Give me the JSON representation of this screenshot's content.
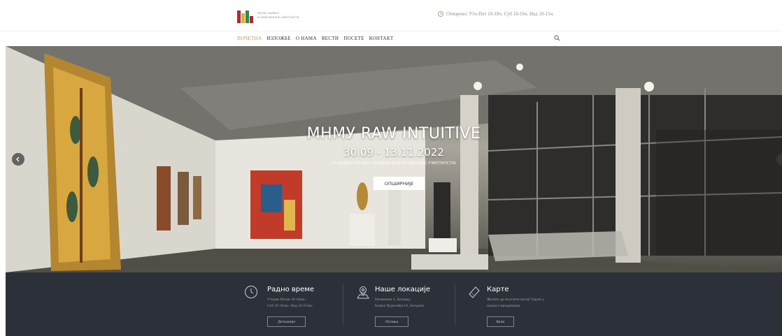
{
  "header": {
    "logo_line1": "музеј наивне",
    "logo_line2": "и маргиналне уметности",
    "hours": "Отворено: Уто-Пет 10-18ч. Суб 10-16ч. Нед 10-15ч."
  },
  "nav": {
    "items": [
      {
        "label": "ПОЧЕТНА",
        "active": true
      },
      {
        "label": "ИЗЛОЖБЕ",
        "active": false
      },
      {
        "label": "О НАМА",
        "active": false
      },
      {
        "label": "ВЕСТИ",
        "active": false
      },
      {
        "label": "ПОСЕТЕ",
        "active": false
      },
      {
        "label": "КОНТАКТ",
        "active": false
      }
    ],
    "search_icon": "search-icon"
  },
  "hero": {
    "title": "MHMУ RAW INTUITIVE",
    "dates": "30.09 - 13.11.2022",
    "subtitle": "ГАЛЕРИЈА МУЗЕЈА НАИВНЕ И МАРГИНАЛНЕ УМЕТНОСТИ",
    "button": "ОПШИРНИЈЕ"
  },
  "info": {
    "hours": {
      "title": "Радно време",
      "line1": "Уторак-Петак 10-18час.",
      "line2": "Суб 10-16час. Нед 10-15час.",
      "button": "Детаљније",
      "icon": "clock-icon"
    },
    "locations": {
      "title": "Наше локације",
      "line1": "Немањина 2, Београд",
      "line2": "Бошка Ђуричића 10, Јагодина",
      "button": "Путања",
      "icon": "map-pin-icon"
    },
    "tickets": {
      "title": "Карте",
      "line1": "Желите да посетите музеј? Карте у",
      "line2": "нашој е-продавници",
      "button": "Купи",
      "icon": "ticket-icon"
    }
  },
  "colors": {
    "accent": "#b89a67",
    "band": "#2c3039"
  }
}
